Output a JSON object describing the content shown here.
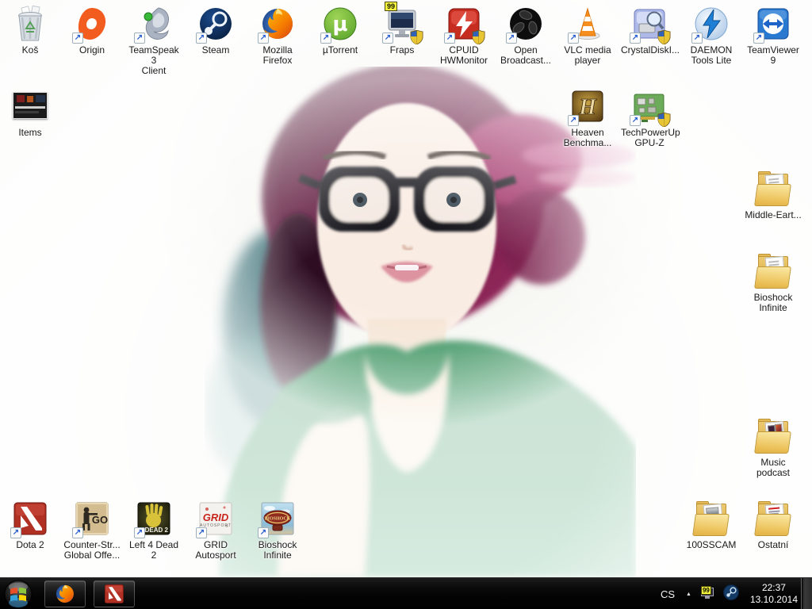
{
  "desktop": {
    "icons": [
      {
        "id": "recycle-bin",
        "type": "recycle",
        "label": [
          "Koš"
        ],
        "col": 0,
        "row": 0,
        "shortcut": false
      },
      {
        "id": "origin",
        "type": "origin",
        "label": [
          "Origin"
        ],
        "col": 1,
        "row": 0,
        "shortcut": true
      },
      {
        "id": "teamspeak",
        "type": "teamspeak",
        "label": [
          "TeamSpeak 3",
          "Client"
        ],
        "col": 2,
        "row": 0,
        "shortcut": true
      },
      {
        "id": "steam",
        "type": "steam",
        "label": [
          "Steam"
        ],
        "col": 3,
        "row": 0,
        "shortcut": true
      },
      {
        "id": "firefox",
        "type": "firefox",
        "label": [
          "Mozilla",
          "Firefox"
        ],
        "col": 4,
        "row": 0,
        "shortcut": true
      },
      {
        "id": "utorrent",
        "type": "utorrent",
        "label": [
          "µTorrent"
        ],
        "glyph": "µ",
        "col": 5,
        "row": 0,
        "shortcut": true
      },
      {
        "id": "fraps",
        "type": "fraps",
        "label": [
          "Fraps"
        ],
        "badge": "99",
        "col": 6,
        "row": 0,
        "shortcut": true,
        "shield": true
      },
      {
        "id": "cpuid-hwmonitor",
        "type": "cpuid",
        "label": [
          "CPUID",
          "HWMonitor"
        ],
        "col": 7,
        "row": 0,
        "shortcut": true,
        "shield": true
      },
      {
        "id": "open-broadcaster",
        "type": "obs",
        "label": [
          "Open",
          "Broadcast..."
        ],
        "col": 8,
        "row": 0,
        "shortcut": true
      },
      {
        "id": "vlc",
        "type": "vlc",
        "label": [
          "VLC media",
          "player"
        ],
        "col": 9,
        "row": 0,
        "shortcut": true
      },
      {
        "id": "crystaldiskinfo",
        "type": "crystal",
        "label": [
          "CrystalDiskI..."
        ],
        "col": 10,
        "row": 0,
        "shortcut": true,
        "shield": true
      },
      {
        "id": "daemon-tools",
        "type": "daemon",
        "label": [
          "DAEMON",
          "Tools Lite"
        ],
        "col": 11,
        "row": 0,
        "shortcut": true
      },
      {
        "id": "teamviewer-9",
        "type": "teamviewer",
        "label": [
          "TeamViewer 9"
        ],
        "col": 12,
        "row": 0,
        "shortcut": true
      },
      {
        "id": "items",
        "type": "screenshot",
        "label": [
          "Items"
        ],
        "col": 0,
        "row": 1,
        "shortcut": false
      },
      {
        "id": "heaven-benchmark",
        "type": "heaven",
        "label": [
          "Heaven",
          "Benchma..."
        ],
        "glyph": "H",
        "col": 9,
        "row": 1,
        "shortcut": true
      },
      {
        "id": "gpu-z",
        "type": "gpuz",
        "label": [
          "TechPowerUp",
          "GPU-Z"
        ],
        "col": 10,
        "row": 1,
        "shortcut": true,
        "shield": true
      },
      {
        "id": "middle-earth-folder",
        "type": "folder",
        "label": [
          "Middle-Eart..."
        ],
        "col": 12,
        "row": 2,
        "shortcut": false
      },
      {
        "id": "bioshock-folder",
        "type": "folder",
        "label": [
          "Bioshock",
          "Infinite"
        ],
        "col": 12,
        "row": 3,
        "shortcut": false
      },
      {
        "id": "music-podcast-folder",
        "type": "folder-music",
        "label": [
          "Music",
          "podcast"
        ],
        "col": 12,
        "row": 5,
        "shortcut": false
      },
      {
        "id": "100sscam-folder",
        "type": "folder-photo",
        "label": [
          "100SSCAM"
        ],
        "col": 11,
        "row": 6,
        "shortcut": false
      },
      {
        "id": "ostatni-folder",
        "type": "folder-docs",
        "label": [
          "Ostatní"
        ],
        "col": 12,
        "row": 6,
        "shortcut": false
      },
      {
        "id": "dota-2",
        "type": "dota2",
        "label": [
          "Dota 2"
        ],
        "col": 0,
        "row": 6,
        "shortcut": true
      },
      {
        "id": "csgo",
        "type": "csgo",
        "label": [
          "Counter-Str...",
          "Global Offe..."
        ],
        "glyph": "GO",
        "col": 1,
        "row": 6,
        "shortcut": true
      },
      {
        "id": "left-4-dead-2",
        "type": "l4d2",
        "label": [
          "Left 4 Dead 2"
        ],
        "glyph": "4 DEAD 2",
        "col": 2,
        "row": 6,
        "shortcut": true
      },
      {
        "id": "grid-autosport",
        "type": "grid",
        "label": [
          "GRID",
          "Autosport"
        ],
        "glyph": "GRID",
        "glyph2": "AUTOSPORT",
        "col": 3,
        "row": 6,
        "shortcut": true
      },
      {
        "id": "bioshock-infinite",
        "type": "bioshock",
        "label": [
          "Bioshock",
          "Infinite"
        ],
        "glyph": "BIOSHOCK",
        "col": 4,
        "row": 6,
        "shortcut": true
      }
    ]
  },
  "taskbar": {
    "apps": [
      {
        "id": "firefox-taskbar",
        "icon": "firefox"
      },
      {
        "id": "dota2-taskbar",
        "icon": "dota2mini"
      }
    ],
    "tray": {
      "language": "CS",
      "expand_glyph": "▲",
      "fraps_badge": "99",
      "time": "22:37",
      "date": "13.10.2014"
    }
  },
  "colors": {
    "taskbar_bg": "#060606",
    "label_text": "#191919",
    "tray_text": "#ffffff",
    "folder_yellow": "#edc35c",
    "shield_blue": "#2f62b8",
    "shield_gold": "#e8c532"
  }
}
